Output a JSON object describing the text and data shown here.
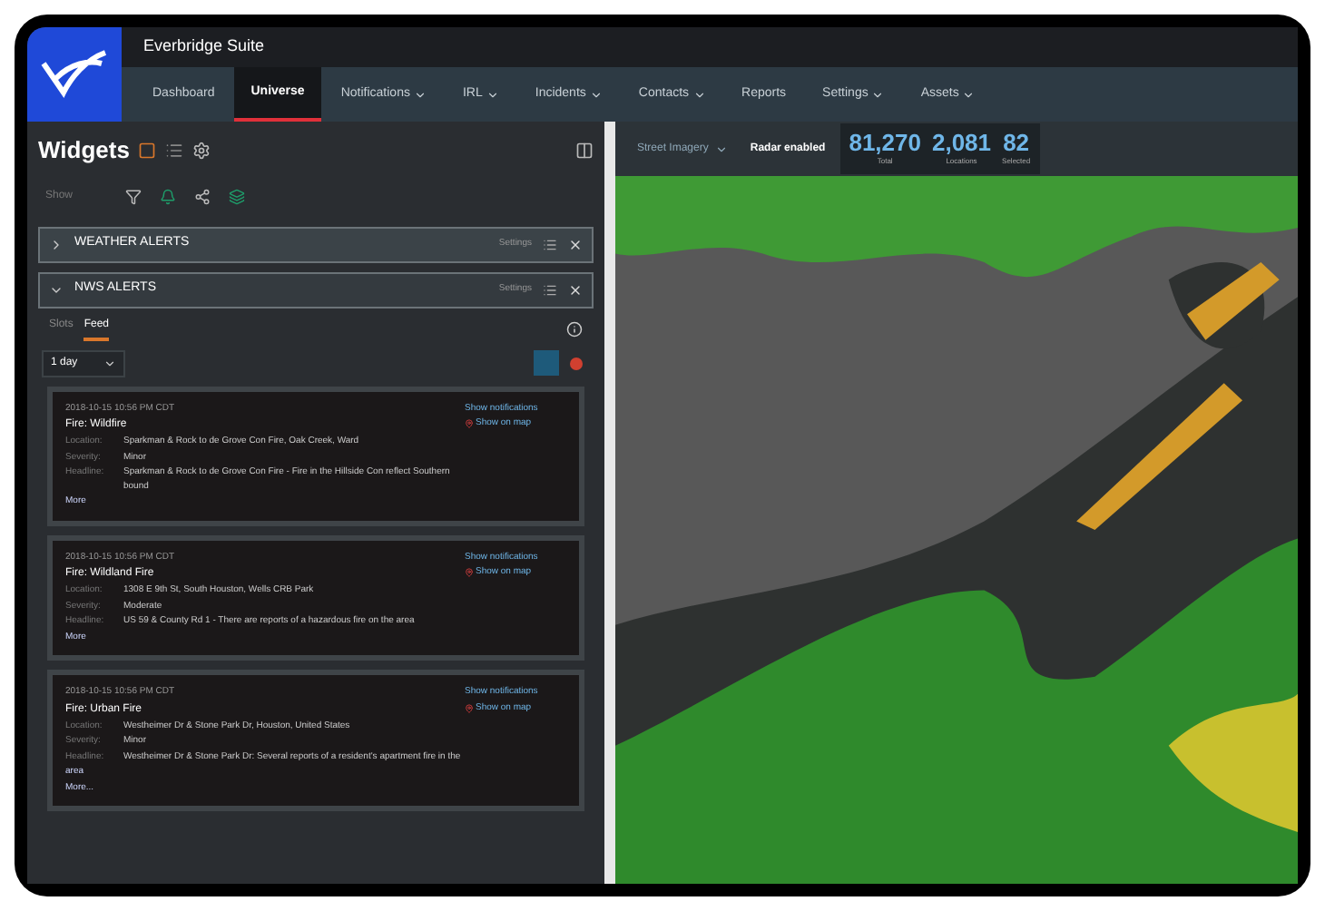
{
  "app": {
    "title": "Everbridge Suite"
  },
  "nav": [
    {
      "label": "Dashboard",
      "selected": false,
      "dropdown": false
    },
    {
      "label": "Universe",
      "selected": true,
      "dropdown": false
    },
    {
      "label": "Notifications",
      "selected": false,
      "dropdown": true
    },
    {
      "label": "IRL",
      "selected": false,
      "dropdown": true
    },
    {
      "label": "Incidents",
      "selected": false,
      "dropdown": true
    },
    {
      "label": "Contacts",
      "selected": false,
      "dropdown": true
    },
    {
      "label": "Reports",
      "selected": false,
      "dropdown": false
    },
    {
      "label": "Settings",
      "selected": false,
      "dropdown": true
    },
    {
      "label": "Assets",
      "selected": false,
      "dropdown": true
    }
  ],
  "panel": {
    "title": "Widgets",
    "filter_label": "Show",
    "sections": [
      {
        "title": "WEATHER ALERTS",
        "expanded": false,
        "status": "Settings"
      },
      {
        "title": "NWS ALERTS",
        "expanded": true,
        "status": "Settings"
      }
    ],
    "tabs": [
      {
        "label": "Slots",
        "selected": false
      },
      {
        "label": "Feed",
        "selected": true
      }
    ],
    "range": "1 day",
    "alerts": [
      {
        "time": "2018-10-15 10:56 PM CDT",
        "title": "Fire: Wildfire",
        "links": [
          "Show notifications",
          "Show on map"
        ],
        "fields": [
          {
            "label": "Location:",
            "value": "Sparkman & Rock to de Grove Con Fire, Oak Creek, Ward"
          },
          {
            "label": "Severity:",
            "value": "Minor"
          },
          {
            "label": "Headline:",
            "value": "Sparkman & Rock to de Grove Con Fire - Fire in the Hillside Con reflect Southern bound"
          }
        ],
        "more": [
          "More"
        ]
      },
      {
        "time": "2018-10-15 10:56 PM CDT",
        "title": "Fire: Wildland Fire",
        "links": [
          "Show notifications",
          "Show on map"
        ],
        "fields": [
          {
            "label": "Location:",
            "value": "1308 E 9th St, South Houston, Wells CRB Park"
          },
          {
            "label": "Severity:",
            "value": "Moderate"
          },
          {
            "label": "Headline:",
            "value": "US 59 & County Rd 1 - There are reports of a hazardous fire on the area"
          }
        ],
        "more": [
          "More"
        ]
      },
      {
        "time": "2018-10-15 10:56 PM CDT",
        "title": "Fire: Urban Fire",
        "links": [
          "Show notifications",
          "Show on map"
        ],
        "fields": [
          {
            "label": "Location:",
            "value": "Westheimer Dr & Stone Park Dr, Houston, United States"
          },
          {
            "label": "Severity:",
            "value": "Minor"
          },
          {
            "label": "Headline:",
            "value": "Westheimer Dr & Stone Park Dr: Several reports of a resident's apartment fire in the"
          }
        ],
        "more": [
          "area",
          "More..."
        ]
      }
    ]
  },
  "map": {
    "view_select": "Street Imagery",
    "mode_label": "Radar enabled",
    "stats": [
      {
        "value": "81,270",
        "label": "Total"
      },
      {
        "value": "2,081",
        "label": "Locations"
      },
      {
        "value": "82",
        "label": "Selected"
      }
    ]
  }
}
